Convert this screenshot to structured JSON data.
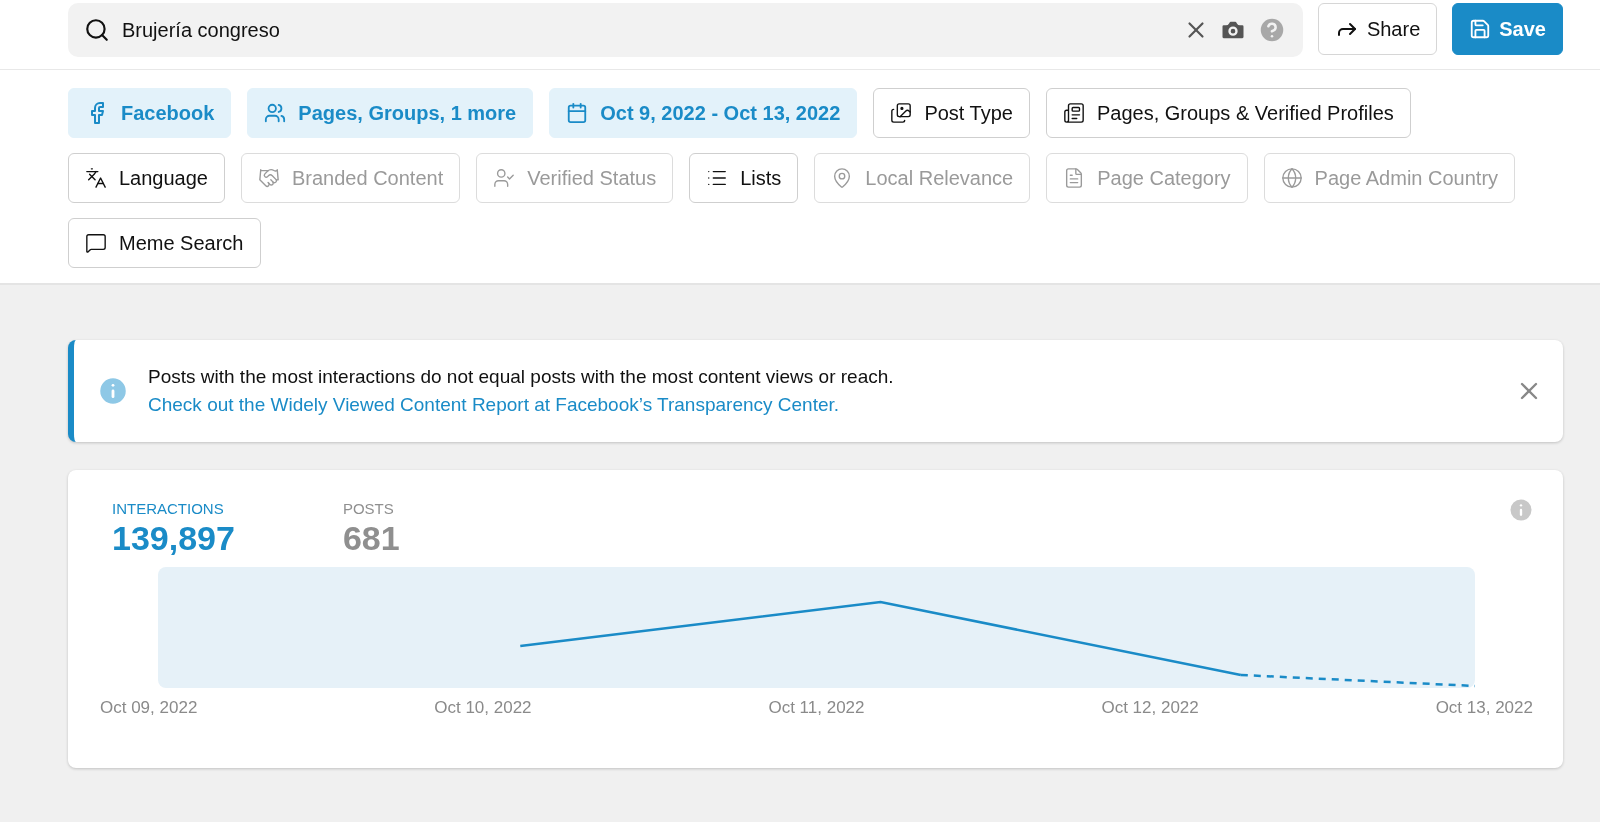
{
  "search": {
    "value": "Brujería congreso"
  },
  "actions": [
    {
      "kind": "share",
      "label": "Share"
    },
    {
      "kind": "save",
      "label": "Save"
    }
  ],
  "filters": [
    {
      "label": "Facebook",
      "kind": "active"
    },
    {
      "label": "Pages, Groups, 1 more",
      "kind": "active"
    },
    {
      "label": "Oct 9, 2022 - Oct 13, 2022",
      "kind": "active"
    },
    {
      "label": "Post Type",
      "kind": "normal"
    },
    {
      "label": "Pages, Groups & Verified Profiles",
      "kind": "normal"
    },
    {
      "label": "Language",
      "kind": "normal"
    },
    {
      "label": "Branded Content",
      "kind": "disabled"
    },
    {
      "label": "Verified Status",
      "kind": "disabled"
    },
    {
      "label": "Lists",
      "kind": "normal"
    },
    {
      "label": "Local Relevance",
      "kind": "disabled"
    },
    {
      "label": "Page Category",
      "kind": "disabled"
    },
    {
      "label": "Page Admin Country",
      "kind": "disabled"
    },
    {
      "label": "Meme Search",
      "kind": "normal"
    }
  ],
  "notice": {
    "text": "Posts with the most interactions do not equal posts with the most content views or reach.",
    "link": "Check out the Widely Viewed Content Report at Facebook’s Transparency Center."
  },
  "stats": {
    "metrics": [
      {
        "label": "INTERACTIONS",
        "value": "139,897",
        "selected": true
      },
      {
        "label": "POSTS",
        "value": "681",
        "selected": false
      }
    ],
    "x_labels": [
      "Oct 09, 2022",
      "Oct 10, 2022",
      "Oct 11, 2022",
      "Oct 12, 2022",
      "Oct 13, 2022"
    ]
  }
}
